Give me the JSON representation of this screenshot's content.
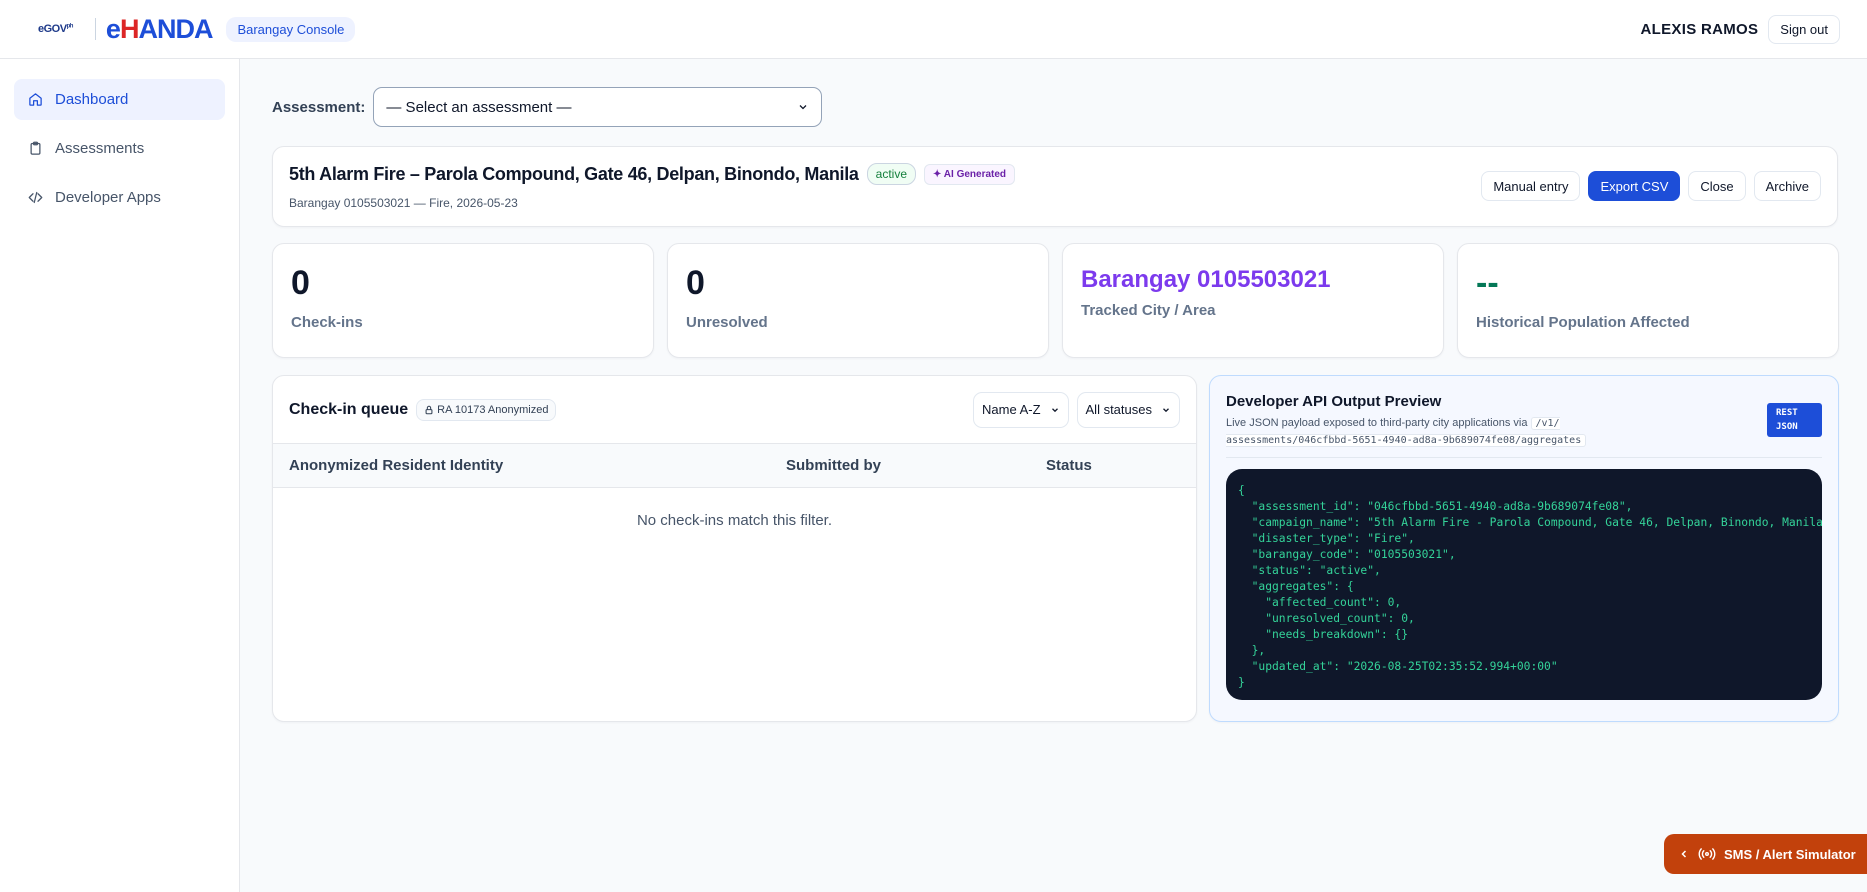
{
  "header": {
    "egov_logo": "eGOV",
    "egov_logo_suffix": "ph",
    "brand_prefix": "e",
    "brand_h": "H",
    "brand_rest": "ANDA",
    "console_label": "Barangay Console",
    "user_name": "ALEXIS RAMOS",
    "signout_label": "Sign out"
  },
  "sidebar": {
    "items": [
      {
        "label": "Dashboard",
        "icon": "home-icon",
        "active": true
      },
      {
        "label": "Assessments",
        "icon": "clipboard-icon",
        "active": false
      },
      {
        "label": "Developer Apps",
        "icon": "code-icon",
        "active": false
      }
    ]
  },
  "assessment": {
    "label": "Assessment:",
    "selected": "— Select an assessment —"
  },
  "campaign": {
    "title": "5th Alarm Fire – Parola Compound, Gate 46, Delpan, Binondo, Manila",
    "status_badge": "active",
    "ai_badge": "AI Generated",
    "subtitle": "Barangay 0105503021 — Fire, 2026-05-23",
    "actions": {
      "manual_entry": "Manual entry",
      "export_csv": "Export CSV",
      "close": "Close",
      "archive": "Archive"
    }
  },
  "stats": {
    "checkins": {
      "value": "0",
      "label": "Check-ins"
    },
    "unresolved": {
      "value": "0",
      "label": "Unresolved"
    },
    "area": {
      "value": "Barangay 0105503021",
      "label": "Tracked City / Area"
    },
    "population": {
      "value": "--",
      "label": "Historical Population Affected"
    }
  },
  "queue": {
    "title": "Check-in queue",
    "privacy_badge": "RA 10173 Anonymized",
    "sort_selected": "Name A-Z",
    "status_selected": "All statuses",
    "columns": [
      "Anonymized Resident Identity",
      "Submitted by",
      "Status"
    ],
    "empty_text": "No check-ins match this filter."
  },
  "api_preview": {
    "title": "Developer API Output Preview",
    "desc": "Live JSON payload exposed to third-party city applications via",
    "endpoint": "/v1/ assessments/046cfbbd-5651-4940-ad8a-9b689074fe08/aggregates",
    "badge_line1": "REST",
    "badge_line2": "JSON",
    "code": "{\n  \"assessment_id\": \"046cfbbd-5651-4940-ad8a-9b689074fe08\",\n  \"campaign_name\": \"5th Alarm Fire - Parola Compound, Gate 46, Delpan, Binondo, Manila\",\n  \"disaster_type\": \"Fire\",\n  \"barangay_code\": \"0105503021\",\n  \"status\": \"active\",\n  \"aggregates\": {\n    \"affected_count\": 0,\n    \"unresolved_count\": 0,\n    \"needs_breakdown\": {}\n  },\n  \"updated_at\": \"2026-08-25T02:35:52.994+00:00\"\n}"
  },
  "sms_simulator": {
    "label": "SMS / Alert Simulator"
  }
}
